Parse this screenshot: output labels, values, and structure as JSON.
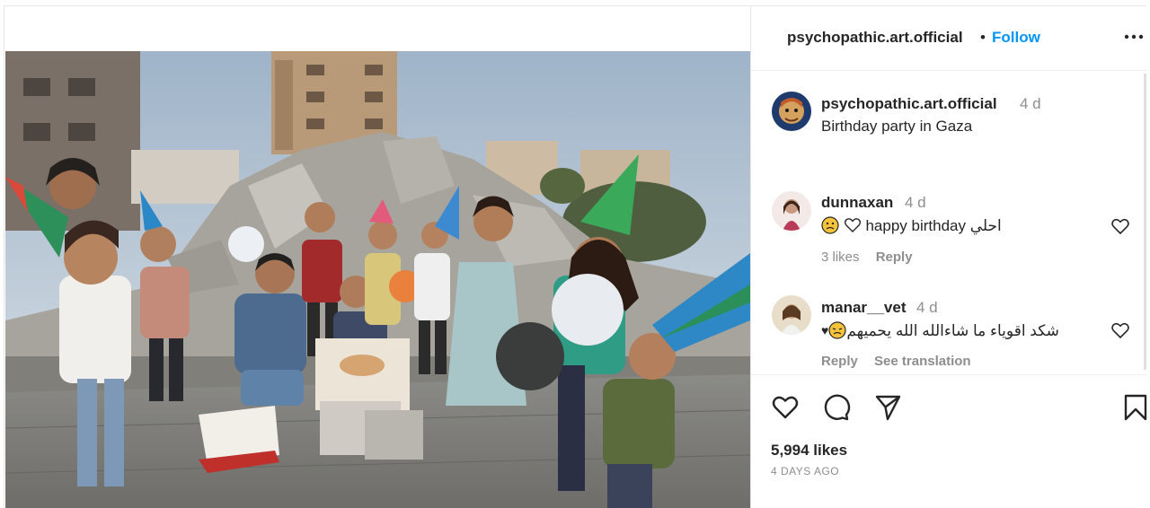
{
  "post": {
    "author": "psychopathic.art.official",
    "separator": "•",
    "follow_label": "Follow",
    "more_icon": "more-horizontal-icon",
    "image_alt": "Children with party hats celebrating a birthday amid rubble"
  },
  "caption": {
    "user": "psychopathic.art.official",
    "time": "4 d",
    "text": "Birthday party in Gaza"
  },
  "comments": [
    {
      "user": "dunnaxan",
      "time": "4 d",
      "text": "happy birthday احلي",
      "likes": "3 likes",
      "reply": "Reply"
    },
    {
      "user": "manar__vet",
      "time": "4 d",
      "text": "شكد اقوياء ما شاءالله الله يحميهم",
      "reply": "Reply",
      "translate": "See translation"
    }
  ],
  "actions": {
    "like_icon": "heart-icon",
    "comment_icon": "comment-icon",
    "share_icon": "share-icon",
    "save_icon": "bookmark-icon",
    "likes": "5,994 likes",
    "date": "4 DAYS AGO"
  },
  "colors": {
    "link_blue": "#0095f6",
    "text": "#262626",
    "muted": "#8e8e8e"
  }
}
